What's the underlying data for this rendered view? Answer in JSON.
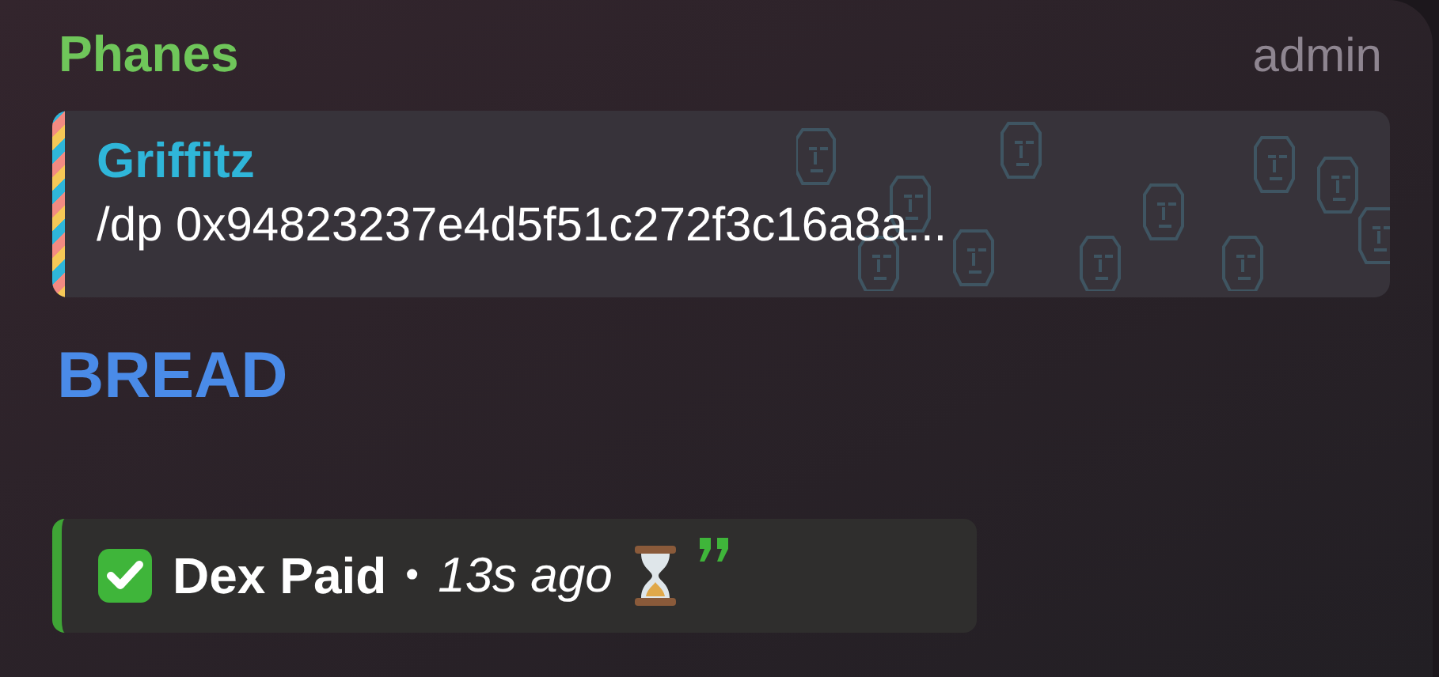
{
  "sender": {
    "name": "Phanes",
    "role": "admin"
  },
  "reply": {
    "author": "Griffitz",
    "text": "/dp 0x94823237e4d5f51c272f3c16a8a..."
  },
  "message": "BREAD",
  "quote": {
    "title": "Dex Paid",
    "separator": "•",
    "time": "13s ago"
  }
}
